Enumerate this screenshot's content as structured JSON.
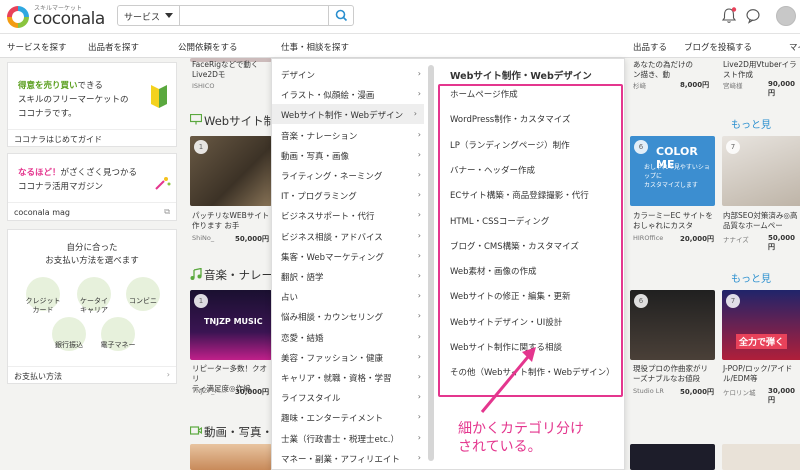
{
  "brand": {
    "tagline": "スキルマーケット",
    "name": "coconala"
  },
  "search": {
    "category": "サービス",
    "placeholder": ""
  },
  "nav": {
    "items": [
      "サービスを探す",
      "出品者を探す",
      "公開依頼をする",
      "仕事・相談を探す"
    ],
    "right": [
      "出品する",
      "ブログを投稿する",
      "マイ"
    ]
  },
  "sidebar": {
    "promo_line1_bold": "得意を売り買い",
    "promo_line1_rest": "できる",
    "promo_line2": "スキルのフリーマーケットの",
    "promo_line3": "ココナラです。",
    "guide_link": "ココナラはじめてガイド",
    "mag_line1_bold": "なるほど！",
    "mag_line1_rest": "がざくざく見つかる",
    "mag_line2": "ココナラ活用マガジン",
    "mag_link": "coconala mag",
    "pay_title1": "自分に合った",
    "pay_title2": "お支払い方法を選べます",
    "pay_methods": [
      "クレジット\nカード",
      "ケータイ\nキャリア",
      "コンビニ",
      "銀行振込",
      "電子マネー"
    ],
    "pay_link": "お支払い方法"
  },
  "sections": {
    "web": {
      "title": "Webサイト制作",
      "more": "もっと見"
    },
    "music": {
      "title": "音楽・ナレーシ",
      "more": "もっと見"
    },
    "video": {
      "title": "動画・写真・画"
    }
  },
  "top_row": {
    "left": {
      "title1": "FaceRigなどで動く",
      "title2": "Live2Dモ",
      "seller": "ISHICO"
    },
    "right1": {
      "title1": "あなたの為だけの",
      "title2": "ン描き、動",
      "seller": "杉﨑",
      "price": "8,000円"
    },
    "right2": {
      "title1": "Live2D用Vtuberイラ",
      "title2": "スト作成",
      "seller": "宮﨑様",
      "price": "90,000円"
    }
  },
  "web_row": {
    "left": {
      "rank": "1",
      "title1": "パッチリなWEBサイト",
      "title2": "作ります お手",
      "seller": "ShiNo_",
      "price": "50,000円"
    },
    "right1": {
      "rank": "6",
      "banner": "COLOR ME",
      "banner_sub": "おしゃれで見やすいショップに\nカスタマイズします",
      "title1": "カラーミーEC サイトを",
      "title2": "おしゃれにカスタ",
      "seller": "HIROffice",
      "price": "20,000円"
    },
    "right2": {
      "rank": "7",
      "title1": "内部SEO対策済み◎高",
      "title2": "品質なホームペー",
      "seller": "ナナイズ",
      "price": "50,000円"
    }
  },
  "music_row": {
    "left": {
      "rank": "1",
      "banner": "TNJZP MUSIC",
      "title1": "リピーター多数！クオリ",
      "title2": "ティ満足度◎作編",
      "seller": "TNJZP_M...",
      "price": "30,000円"
    },
    "right1": {
      "rank": "6",
      "title1": "現役プロの作曲家がリ",
      "title2": "ーズナブルなお値段",
      "seller": "Studio LR",
      "price": "50,000円"
    },
    "right2": {
      "rank": "7",
      "banner": "全力で弾く",
      "title1": "J-POP/ロック/アイド",
      "title2": "ル/EDM等",
      "seller": "ケロリン城",
      "price": "30,000円"
    }
  },
  "dropdown": {
    "categories": [
      "デザイン",
      "イラスト・似顔絵・漫画",
      "Webサイト制作・Webデザイン",
      "音楽・ナレーション",
      "動画・写真・画像",
      "ライティング・ネーミング",
      "IT・プログラミング",
      "ビジネスサポート・代行",
      "ビジネス相談・アドバイス",
      "集客・Webマーケティング",
      "翻訳・語学",
      "占い",
      "悩み相談・カウンセリング",
      "恋愛・結婚",
      "美容・ファッション・健康",
      "キャリア・就職・資格・学習",
      "ライフスタイル",
      "趣味・エンターテイメント",
      "士業（行政書士・税理士etc.）",
      "マネー・副業・アフィリエイト"
    ],
    "active_index": 2,
    "sub_title": "Webサイト制作・Webデザイン",
    "sub_items": [
      "ホームページ作成",
      "WordPress制作・カスタマイズ",
      "LP（ランディングページ）制作",
      "バナー・ヘッダー作成",
      "ECサイト構築・商品登録撮影・代行",
      "HTML・CSSコーディング",
      "ブログ・CMS構築・カスタマイズ",
      "Web素材・画像の作成",
      "Webサイトの修正・編集・更新",
      "Webサイトデザイン・UI設計",
      "Webサイト制作に関する相談",
      "その他（Webサイト制作・Webデザイン）"
    ]
  },
  "annotation": {
    "line1": "細かくカテゴリ分け",
    "line2": "されている。"
  },
  "colors": {
    "highlight": "#e4368e",
    "link": "#2a8fcf",
    "accent_green": "#8ac43f"
  }
}
